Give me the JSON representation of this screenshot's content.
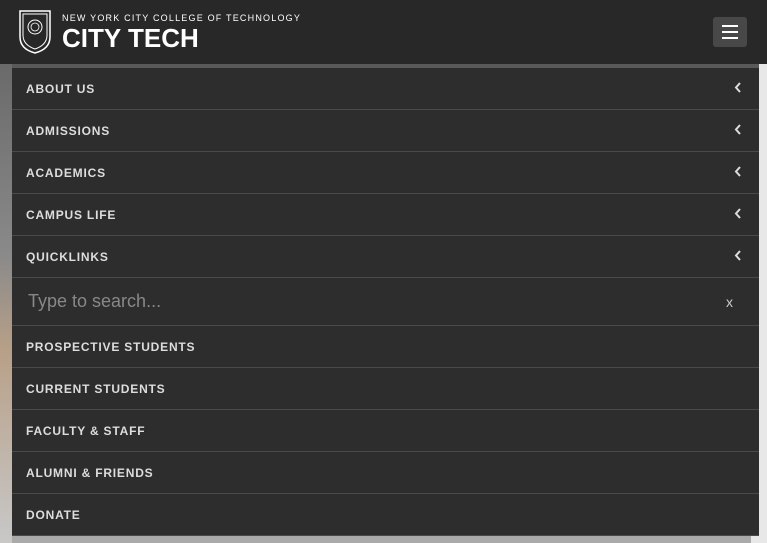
{
  "header": {
    "logo_subtitle": "NEW YORK CITY COLLEGE OF TECHNOLOGY",
    "logo_title": "CITY TECH"
  },
  "menu": {
    "primary": [
      {
        "label": "ABOUT US",
        "has_submenu": true
      },
      {
        "label": "ADMISSIONS",
        "has_submenu": true
      },
      {
        "label": "ACADEMICS",
        "has_submenu": true
      },
      {
        "label": "CAMPUS LIFE",
        "has_submenu": true
      },
      {
        "label": "QUICKLINKS",
        "has_submenu": true
      }
    ],
    "secondary": [
      {
        "label": "PROSPECTIVE STUDENTS"
      },
      {
        "label": "CURRENT STUDENTS"
      },
      {
        "label": "FACULTY & STAFF"
      },
      {
        "label": "ALUMNI & FRIENDS"
      },
      {
        "label": "DONATE"
      }
    ]
  },
  "search": {
    "placeholder": "Type to search...",
    "close_label": "x"
  }
}
